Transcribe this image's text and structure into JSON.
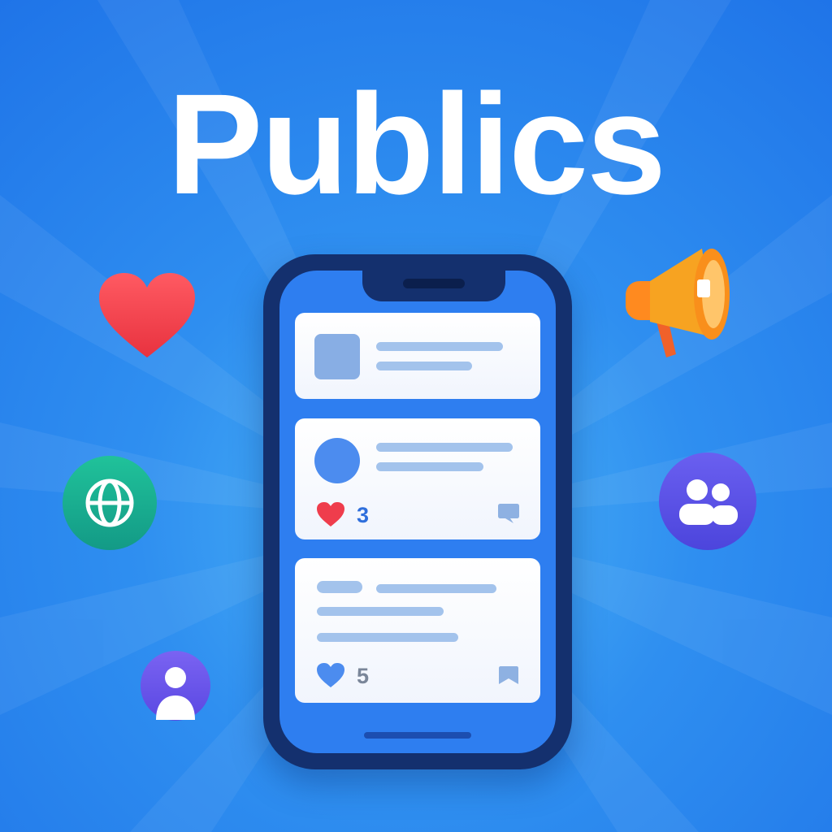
{
  "title": "Publics",
  "colors": {
    "background": "#2f8ff0",
    "phone_frame": "#14306e",
    "screen": "#2e7ef0",
    "card": "#ffffff",
    "placeholder_bar": "#a3c3ec",
    "heart_red": "#ef3d4c",
    "like_count_blue": "#2f6fdc",
    "globe_green": "#1fb596",
    "megaphone_orange": "#f7941d",
    "group_purple": "#5b55e6",
    "user_purple": "#6553ea"
  },
  "floating_icons": {
    "heart": "heart-icon",
    "globe": "globe-icon",
    "user": "user-icon",
    "megaphone": "megaphone-icon",
    "group": "group-icon"
  },
  "feed": {
    "post_with_avatar": {
      "like_icon": "heart-filled-icon",
      "like_count": "3",
      "comment_icon": "comment-icon"
    },
    "text_post": {
      "like_icon": "heart-outline-icon",
      "like_count": "5",
      "save_icon": "bookmark-icon"
    }
  }
}
